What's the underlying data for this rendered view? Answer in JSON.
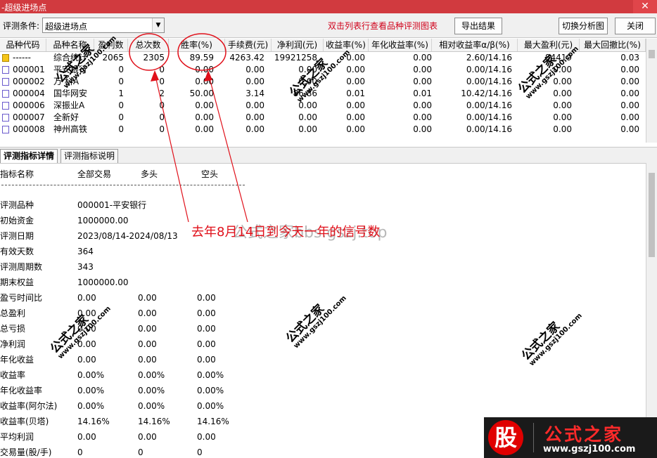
{
  "window": {
    "title": "-超级进场点",
    "close_glyph": "✕"
  },
  "toolbar": {
    "condition_label": "评测条件:",
    "condition_value": "超级进场点",
    "hint": "双击列表行查看品种评测图表",
    "export_label": "导出结果",
    "switch_label": "切换分析图",
    "close_label": "关闭"
  },
  "grid": {
    "headers": [
      "品种代码",
      "品种名称",
      "盈利数",
      "总次数",
      "胜率(%)",
      "手续费(元)",
      "净利润(元)",
      "收益率(%)",
      "年化收益率(%)",
      "相对收益率α/β(%)",
      "最大盈利(元)",
      "最大回撤比(%)"
    ],
    "rows": [
      [
        "------",
        "综合统计",
        "2065",
        "2305",
        "89.59",
        "4263.42",
        "19921258",
        "0.00",
        "0.00",
        "2.60/14.16",
        "84419",
        "0.03"
      ],
      [
        "000001",
        "平安银行",
        "0",
        "0",
        "0.00",
        "0.00",
        "0.00",
        "0.00",
        "0.00",
        "0.00/14.16",
        "0.00",
        "0.00"
      ],
      [
        "000002",
        "万 科A",
        "0",
        "0",
        "0.00",
        "0.00",
        "0.00",
        "0.00",
        "0.00",
        "0.00/14.16",
        "0.00",
        "0.00"
      ],
      [
        "000004",
        "国华网安",
        "1",
        "2",
        "50.00",
        "3.14",
        "86.86",
        "0.01",
        "0.01",
        "10.42/14.16",
        "0.00",
        "0.00"
      ],
      [
        "000006",
        "深振业A",
        "0",
        "0",
        "0.00",
        "0.00",
        "0.00",
        "0.00",
        "0.00",
        "0.00/14.16",
        "0.00",
        "0.00"
      ],
      [
        "000007",
        "全新好",
        "0",
        "0",
        "0.00",
        "0.00",
        "0.00",
        "0.00",
        "0.00",
        "0.00/14.16",
        "0.00",
        "0.00"
      ],
      [
        "000008",
        "神州高铁",
        "0",
        "0",
        "0.00",
        "0.00",
        "0.00",
        "0.00",
        "0.00",
        "0.00/14.16",
        "0.00",
        "0.00"
      ]
    ]
  },
  "tabs": [
    "评测指标详情",
    "评测指标说明"
  ],
  "detail": {
    "headers": [
      "指标名称",
      "全部交易",
      "多头",
      "空头"
    ],
    "rows": [
      [
        "评测品种",
        "000001-平安银行",
        "",
        ""
      ],
      [
        "初始资金",
        "1000000.00",
        "",
        ""
      ],
      [
        "评测日期",
        "2023/08/14-2024/08/13",
        "",
        ""
      ],
      [
        "有效天数",
        "364",
        "",
        ""
      ],
      [
        "评测周期数",
        "343",
        "",
        ""
      ],
      [
        "期末权益",
        "1000000.00",
        "",
        ""
      ],
      [
        "盈亏时间比",
        "0.00",
        "0.00",
        "0.00"
      ],
      [
        "总盈利",
        "0.00",
        "0.00",
        "0.00"
      ],
      [
        "总亏损",
        "0.00",
        "0.00",
        "0.00"
      ],
      [
        "净利润",
        "0.00",
        "0.00",
        "0.00"
      ],
      [
        "年化收益",
        "0.00",
        "0.00",
        "0.00"
      ],
      [
        "收益率",
        "0.00%",
        "0.00%",
        "0.00%"
      ],
      [
        "年化收益率",
        "0.00%",
        "0.00%",
        "0.00%"
      ],
      [
        "收益率(阿尔法)",
        "0.00%",
        "0.00%",
        "0.00%"
      ],
      [
        "收益率(贝塔)",
        "14.16%",
        "14.16%",
        "14.16%"
      ],
      [
        "平均利润",
        "0.00",
        "0.00",
        "0.00"
      ],
      [
        "交易量(股/手)",
        "0",
        "0",
        "0"
      ]
    ]
  },
  "annotation": {
    "text": "去年8月14日到今天一年的信号数",
    "color": "#e0101a"
  },
  "watermark": {
    "big": "公式之家bbs.gszj.top",
    "title": "公式之家",
    "url": "www.gszj100.com"
  },
  "logo": {
    "badge": "股",
    "name": "公式之家",
    "url": "www.gszj100.com"
  }
}
